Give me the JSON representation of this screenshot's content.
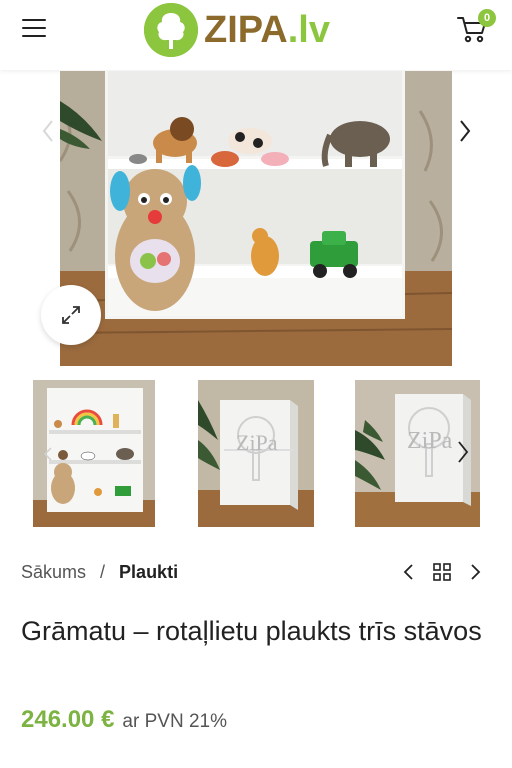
{
  "header": {
    "logo_main": "ZIPA",
    "logo_tld": ".lv",
    "cart_count": "0",
    "brand_color": "#8cc63e",
    "logo_text_color": "#8b6a2c"
  },
  "gallery": {
    "thumb_watermark": "ZiPa"
  },
  "breadcrumb": {
    "home": "Sākums",
    "separator": "/",
    "current": "Plaukti"
  },
  "product": {
    "title": "Grāmatu – rotaļlietu plaukts trīs stāvos",
    "price": "246.00 €",
    "vat_note": "ar PVN 21%",
    "price_color": "#7cb342"
  },
  "icons": {
    "menu": "hamburger-menu-icon",
    "cart": "cart-icon",
    "zoom": "expand-icon",
    "prev": "chevron-left-icon",
    "next": "chevron-right-icon",
    "grid": "grid-icon"
  }
}
